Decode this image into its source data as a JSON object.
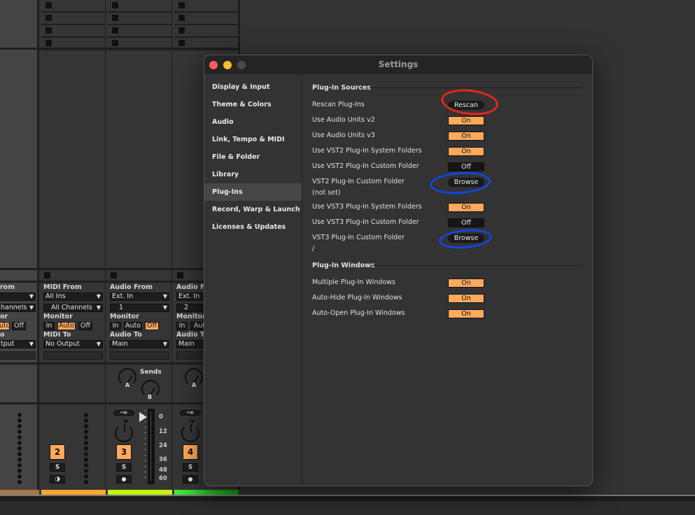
{
  "settings_window": {
    "title": "Settings",
    "traffic_lights": {
      "close": "#ff5f57",
      "minimize": "#febc2e",
      "zoom": "#4a4a4a"
    },
    "sidebar": {
      "items": [
        {
          "label": "Display & Input",
          "active": false
        },
        {
          "label": "Theme & Colors",
          "active": false
        },
        {
          "label": "Audio",
          "active": false
        },
        {
          "label": "Link, Tempo & MIDI",
          "active": false
        },
        {
          "label": "File & Folder",
          "active": false
        },
        {
          "label": "Library",
          "active": false
        },
        {
          "label": "Plug-Ins",
          "active": true
        },
        {
          "label": "Record, Warp & Launch",
          "active": false
        },
        {
          "label": "Licenses & Updates",
          "active": false
        }
      ]
    },
    "plugin_sources": {
      "heading": "Plug-In Sources",
      "rescan": {
        "label": "Rescan Plug-Ins",
        "button": "Rescan"
      },
      "au_v2": {
        "label": "Use Audio Units v2",
        "value": "On"
      },
      "au_v3": {
        "label": "Use Audio Units v3",
        "value": "On"
      },
      "vst2_system": {
        "label": "Use VST2 Plug-In System Folders",
        "value": "On"
      },
      "vst2_custom_use": {
        "label": "Use VST2 Plug-In Custom Folder",
        "value": "Off"
      },
      "vst2_custom_folder": {
        "label": "VST2 Plug-In Custom Folder",
        "path": "(not set)",
        "button": "Browse"
      },
      "vst3_system": {
        "label": "Use VST3 Plug-In System Folders",
        "value": "On"
      },
      "vst3_custom_use": {
        "label": "Use VST3 Plug-In Custom Folder",
        "value": "Off"
      },
      "vst3_custom_folder": {
        "label": "VST3 Plug-In Custom Folder",
        "path": "/",
        "button": "Browse"
      }
    },
    "plugin_windows": {
      "heading": "Plug-In Windows",
      "multiple": {
        "label": "Multiple Plug-In Windows",
        "value": "On"
      },
      "auto_hide": {
        "label": "Auto-Hide Plug-In Windows",
        "value": "On"
      },
      "auto_open": {
        "label": "Auto-Open Plug-In Windows",
        "value": "On"
      }
    }
  },
  "annotations": {
    "rescan_circle_color": "#e8261a",
    "browse_circle_color": "#1246e0"
  },
  "mixer": {
    "track1": {
      "from_label": "rom",
      "channel": "hannels",
      "monitor_label": "or",
      "monitor_auto": "uto",
      "monitor_off": "Off",
      "to_label": "o",
      "to_value": "tput"
    },
    "track2": {
      "from_label": "MIDI From",
      "from_value": "All Ins",
      "channel": "All Channels",
      "monitor_label": "Monitor",
      "monitor_in": "In",
      "monitor_auto": "Auto",
      "monitor_off": "Off",
      "to_label": "MIDI To",
      "to_value": "No Output",
      "number": "2",
      "solo": "S"
    },
    "track3": {
      "from_label": "Audio From",
      "from_value": "Ext. In",
      "channel": "1",
      "monitor_label": "Monitor",
      "monitor_in": "In",
      "monitor_auto": "Auto",
      "monitor_off": "Off",
      "to_label": "Audio To",
      "to_value": "Main",
      "sends_label": "Sends",
      "send_a": "A",
      "send_b": "B",
      "volume": "-∞",
      "number": "3",
      "solo": "S",
      "db_scale": [
        "0",
        "12",
        "24",
        "36",
        "48",
        "60"
      ]
    },
    "track4": {
      "from_label": "Audio Fr",
      "from_value": "Ext. In",
      "channel": "2",
      "monitor_label": "Monitor",
      "monitor_in": "In",
      "monitor_auto": "Aut",
      "to_label": "Audio To",
      "to_value": "Main",
      "send_a": "A",
      "volume": "-∞",
      "number": "4",
      "solo": "S"
    },
    "track_colors": [
      "#a4784a",
      "#ffa530",
      "#c2f20e",
      "#35e03a"
    ]
  }
}
